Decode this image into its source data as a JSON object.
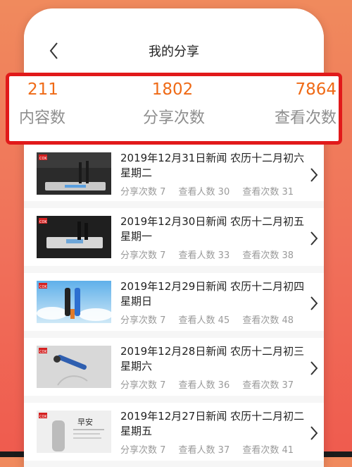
{
  "header": {
    "title": "我的分享"
  },
  "stats": {
    "content": {
      "value": "211",
      "label": "内容数"
    },
    "shares": {
      "value": "1802",
      "label": "分享次数"
    },
    "views": {
      "value": "7864",
      "label": "查看次数"
    }
  },
  "items": [
    {
      "title": "2019年12月31日新闻 农历十二月初六 星期二",
      "share_count": "分享次数 7",
      "viewer_count": "查看人数 30",
      "view_count": "查看次数 31",
      "thumb_brand": "COK"
    },
    {
      "title": "2019年12月30日新闻 农历十二月初五 星期一",
      "share_count": "分享次数 7",
      "viewer_count": "查看人数 33",
      "view_count": "查看次数 38",
      "thumb_brand": "COK"
    },
    {
      "title": "2019年12月29日新闻 农历十二月初四 星期日",
      "share_count": "分享次数 7",
      "viewer_count": "查看人数 45",
      "view_count": "查看次数 48",
      "thumb_brand": "COK"
    },
    {
      "title": "2019年12月28日新闻 农历十二月初三 星期六",
      "share_count": "分享次数 7",
      "viewer_count": "查看人数 36",
      "view_count": "查看次数 37",
      "thumb_brand": "COK"
    },
    {
      "title": "2019年12月27日新闻 农历十二月初二 星期五",
      "share_count": "分享次数 7",
      "viewer_count": "查看人数 37",
      "view_count": "查看次数 41",
      "thumb_brand": "COK",
      "thumb_text": "早安"
    }
  ],
  "colors": {
    "accent": "#ef6a16",
    "highlight_border": "#e1191a",
    "background": "#f0705a"
  }
}
